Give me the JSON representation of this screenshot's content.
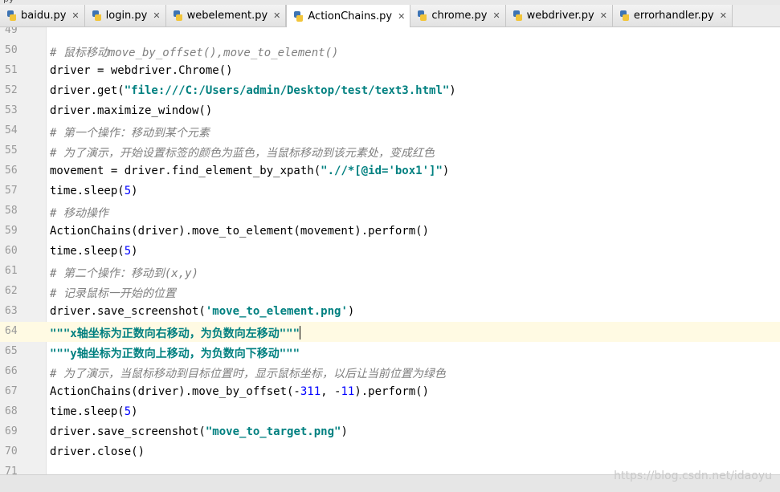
{
  "tabs": [
    {
      "label": "baidu.py",
      "active": false
    },
    {
      "label": "login.py",
      "active": false
    },
    {
      "label": "webelement.py",
      "active": false
    },
    {
      "label": "ActionChains.py",
      "active": true
    },
    {
      "label": "chrome.py",
      "active": false
    },
    {
      "label": "webdriver.py",
      "active": false
    },
    {
      "label": "errorhandler.py",
      "active": false
    }
  ],
  "close_glyph": "✕",
  "icon": "python-file-icon",
  "editor": {
    "current_line": 64,
    "lines": [
      {
        "n": "49",
        "parts": []
      },
      {
        "n": "50",
        "parts": [
          {
            "t": "# 鼠标移动move_by_offset(),move_to_element()",
            "c": "cm"
          }
        ]
      },
      {
        "n": "51",
        "parts": [
          {
            "t": "driver = webdriver.Chrome()",
            "c": ""
          }
        ]
      },
      {
        "n": "52",
        "parts": [
          {
            "t": "driver.get(",
            "c": ""
          },
          {
            "t": "\"file:///C:/Users/admin/Desktop/test/text3.html\"",
            "c": "st"
          },
          {
            "t": ")",
            "c": ""
          }
        ]
      },
      {
        "n": "53",
        "parts": [
          {
            "t": "driver.maximize_window()",
            "c": ""
          }
        ]
      },
      {
        "n": "54",
        "parts": [
          {
            "t": "# 第一个操作：移动到某个元素",
            "c": "cm"
          }
        ]
      },
      {
        "n": "55",
        "parts": [
          {
            "t": "# 为了演示，开始设置标签的颜色为蓝色，当鼠标移动到该元素处，变成红色",
            "c": "cm"
          }
        ]
      },
      {
        "n": "56",
        "parts": [
          {
            "t": "movement = driver.find_element_by_xpath(",
            "c": ""
          },
          {
            "t": "\".//*[@id='box1']\"",
            "c": "st"
          },
          {
            "t": ")",
            "c": ""
          }
        ]
      },
      {
        "n": "57",
        "parts": [
          {
            "t": "time.sleep(",
            "c": ""
          },
          {
            "t": "5",
            "c": "nm"
          },
          {
            "t": ")",
            "c": ""
          }
        ]
      },
      {
        "n": "58",
        "parts": [
          {
            "t": "# 移动操作",
            "c": "cm"
          }
        ]
      },
      {
        "n": "59",
        "parts": [
          {
            "t": "ActionChains(driver).move_to_element(movement).perform()",
            "c": ""
          }
        ]
      },
      {
        "n": "60",
        "parts": [
          {
            "t": "time.sleep(",
            "c": ""
          },
          {
            "t": "5",
            "c": "nm"
          },
          {
            "t": ")",
            "c": ""
          }
        ]
      },
      {
        "n": "61",
        "parts": [
          {
            "t": "# 第二个操作：移动到(x,y)",
            "c": "cm"
          }
        ]
      },
      {
        "n": "62",
        "parts": [
          {
            "t": "# 记录鼠标一开始的位置",
            "c": "cm"
          }
        ]
      },
      {
        "n": "63",
        "parts": [
          {
            "t": "driver.save_screenshot(",
            "c": ""
          },
          {
            "t": "'move_to_element.png'",
            "c": "st"
          },
          {
            "t": ")",
            "c": ""
          }
        ]
      },
      {
        "n": "64",
        "parts": [
          {
            "t": "\"\"\"x轴坐标为正数向右移动，为负数向左移动\"\"\"",
            "c": "st"
          }
        ]
      },
      {
        "n": "65",
        "parts": [
          {
            "t": "\"\"\"y轴坐标为正数向上移动，为负数向下移动\"\"\"",
            "c": "st"
          }
        ]
      },
      {
        "n": "66",
        "parts": [
          {
            "t": "# 为了演示，当鼠标移动到目标位置时，显示鼠标坐标，以后让当前位置为绿色",
            "c": "cm"
          }
        ]
      },
      {
        "n": "67",
        "parts": [
          {
            "t": "ActionChains(driver).move_by_offset(-",
            "c": ""
          },
          {
            "t": "311",
            "c": "nm"
          },
          {
            "t": ", -",
            "c": ""
          },
          {
            "t": "11",
            "c": "nm"
          },
          {
            "t": ").perform()",
            "c": ""
          }
        ]
      },
      {
        "n": "68",
        "parts": [
          {
            "t": "time.sleep(",
            "c": ""
          },
          {
            "t": "5",
            "c": "nm"
          },
          {
            "t": ")",
            "c": ""
          }
        ]
      },
      {
        "n": "69",
        "parts": [
          {
            "t": "driver.save_screenshot(",
            "c": ""
          },
          {
            "t": "\"move_to_target.png\"",
            "c": "st"
          },
          {
            "t": ")",
            "c": ""
          }
        ]
      },
      {
        "n": "70",
        "parts": [
          {
            "t": "driver.close()",
            "c": ""
          }
        ]
      },
      {
        "n": "71",
        "parts": []
      }
    ]
  },
  "watermark": "https://blog.csdn.net/idaoyu",
  "colors": {
    "comment": "#808080",
    "string": "#008080",
    "number": "#0000ff",
    "current_line": "#fffae3"
  }
}
